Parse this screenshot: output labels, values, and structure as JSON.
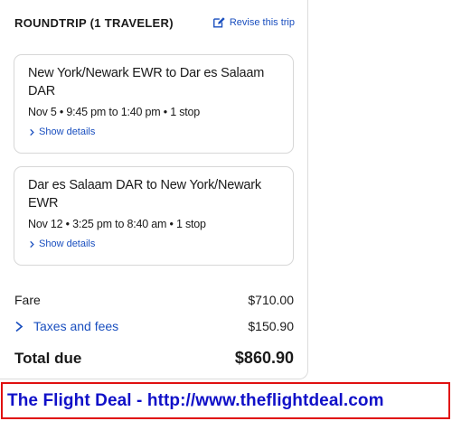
{
  "trip": {
    "type_label": "ROUNDTRIP (1 TRAVELER)",
    "revise_label": "Revise this trip"
  },
  "flights": [
    {
      "route": "New York/Newark EWR to Dar es Salaam DAR",
      "times": "Nov 5 • 9:45 pm to 1:40 pm • 1 stop",
      "details_label": "Show details"
    },
    {
      "route": "Dar es Salaam DAR to New York/Newark EWR",
      "times": "Nov 12 • 3:25 pm to 8:40 am • 1 stop",
      "details_label": "Show details"
    }
  ],
  "pricing": {
    "fare_label": "Fare",
    "fare_value": "$710.00",
    "taxes_label": "Taxes and fees",
    "taxes_value": "$150.90",
    "total_label": "Total due",
    "total_value": "$860.90"
  },
  "banner": {
    "text": "The Flight Deal - http://www.theflightdeal.com"
  },
  "colors": {
    "link": "#1a4fbf",
    "banner_border": "#e01010",
    "banner_text": "#1010c8"
  },
  "icons": {
    "revise": "edit-icon",
    "details": "chevron-right-icon",
    "taxes": "chevron-right-icon"
  }
}
